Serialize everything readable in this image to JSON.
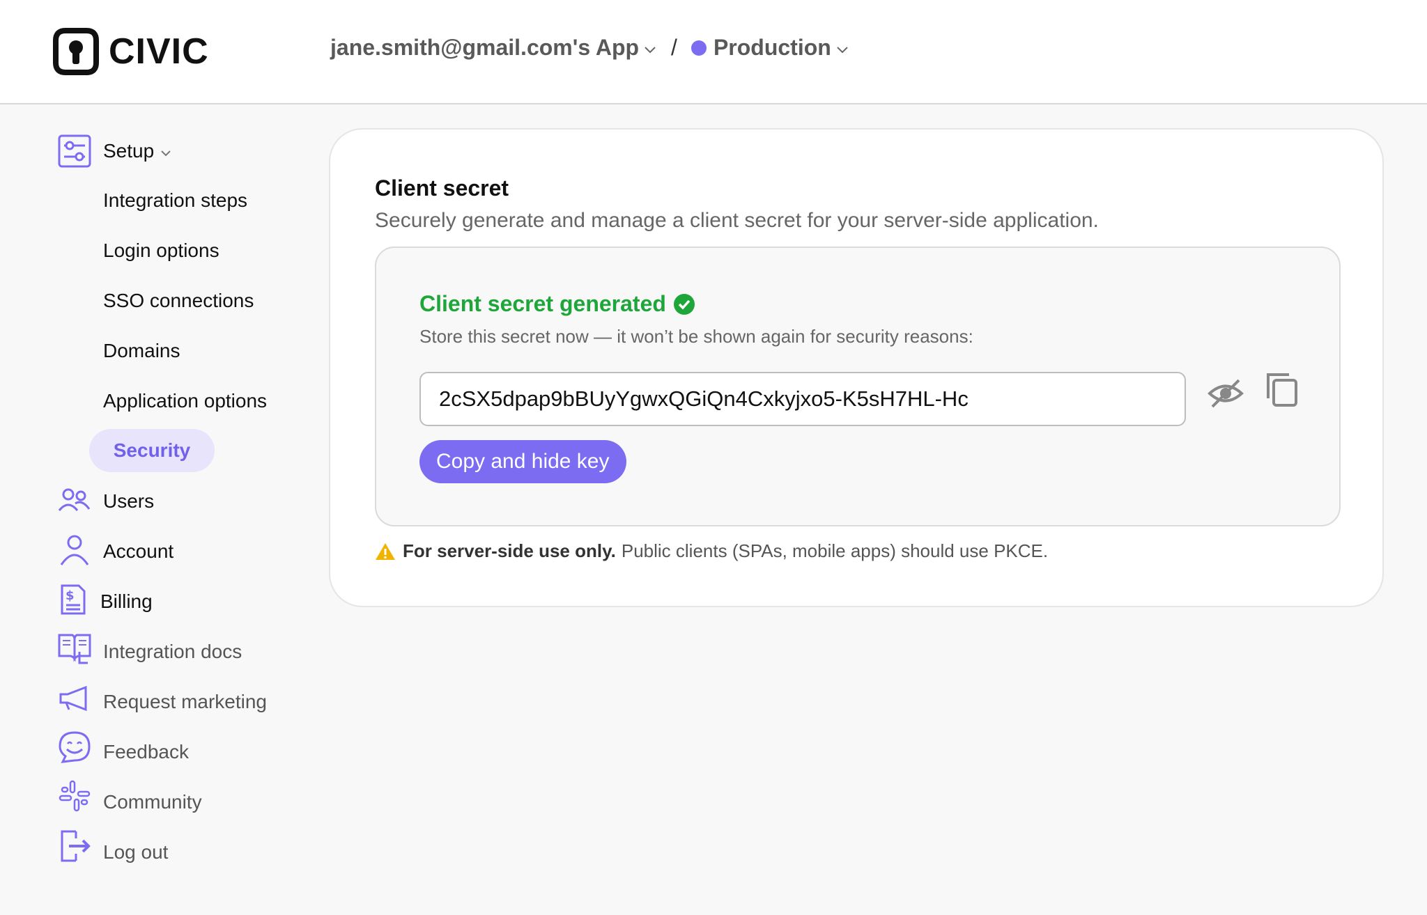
{
  "brand": {
    "name": "CIVIC"
  },
  "breadcrumb": {
    "app": "jane.smith@gmail.com's App",
    "separator": "/",
    "environment": "Production",
    "env_color": "#7c6cf2"
  },
  "sidebar": {
    "setup_label": "Setup",
    "setup_items": [
      {
        "label": "Integration steps"
      },
      {
        "label": "Login options"
      },
      {
        "label": "SSO connections"
      },
      {
        "label": "Domains"
      },
      {
        "label": "Application options"
      },
      {
        "label": "Security",
        "active": true
      }
    ],
    "items": [
      {
        "label": "Users",
        "icon": "users-icon"
      },
      {
        "label": "Account",
        "icon": "person-icon"
      },
      {
        "label": "Billing",
        "icon": "invoice-icon"
      },
      {
        "label": "Integration docs",
        "icon": "book-icon"
      },
      {
        "label": "Request marketing",
        "icon": "megaphone-icon"
      },
      {
        "label": "Feedback",
        "icon": "smiley-chat-icon"
      },
      {
        "label": "Community",
        "icon": "slack-icon"
      },
      {
        "label": "Log out",
        "icon": "logout-icon"
      }
    ]
  },
  "card": {
    "title": "Client secret",
    "subtitle": "Securely generate and manage a client secret for your server-side application.",
    "generated_title": "Client secret generated",
    "generated_sub": "Store this secret now — it won’t be shown again for security reasons:",
    "secret_value": "2cSX5dpap9bBUyYgwxQGiQn4Cxkyjxo5-K5sH7HL-Hc",
    "copy_hide_label": "Copy and hide key",
    "note_bold": "For server-side use only.",
    "note_text": "Public clients (SPAs, mobile apps) should use PKCE."
  },
  "colors": {
    "accent": "#7c6cf2",
    "success": "#1fa63a",
    "warning": "#f0b400"
  }
}
